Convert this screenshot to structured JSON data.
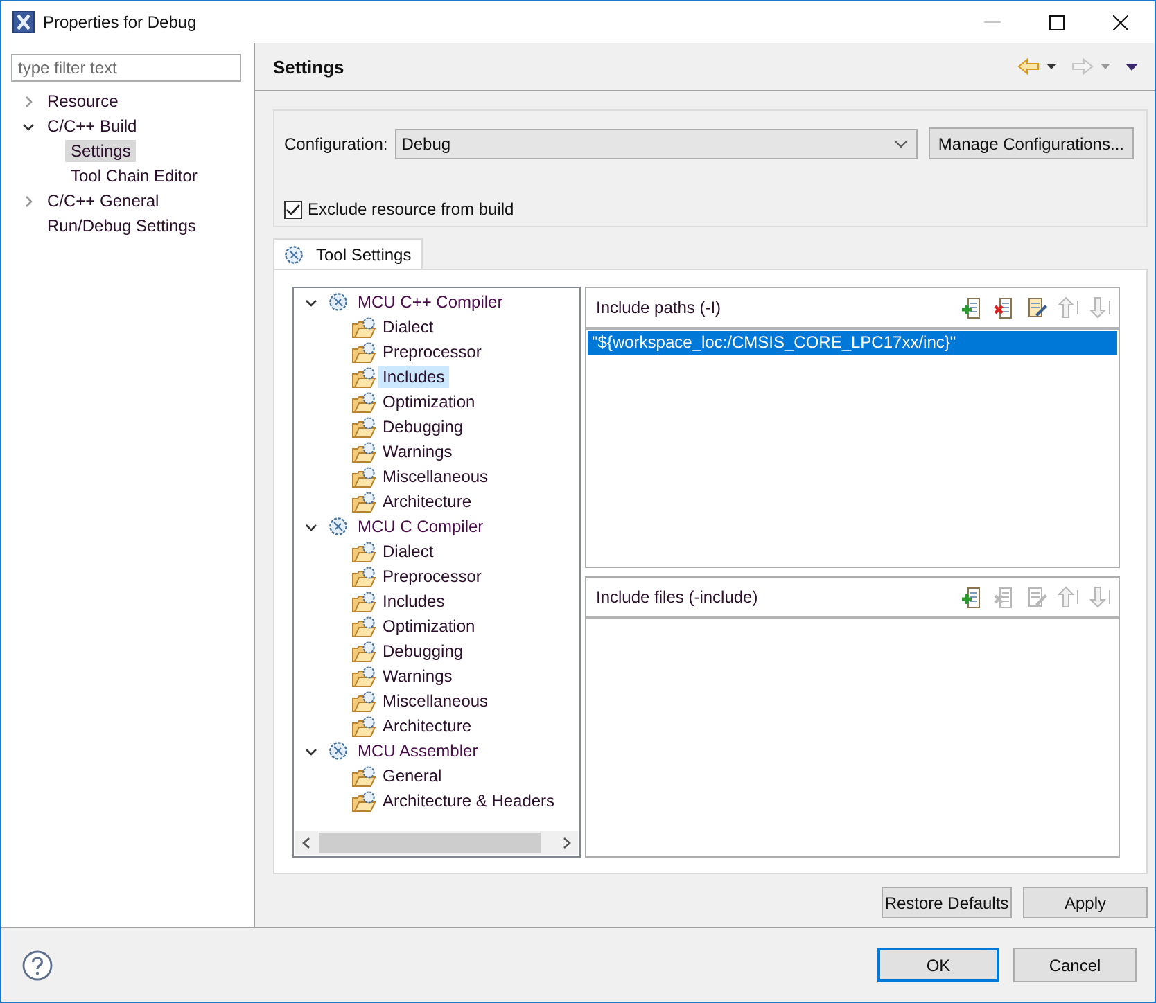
{
  "window": {
    "title": "Properties for Debug"
  },
  "filter": {
    "placeholder": "type filter text"
  },
  "sidebar": {
    "items": [
      {
        "label": "Resource",
        "expanded": false,
        "selected": false
      },
      {
        "label": "C/C++ Build",
        "expanded": true,
        "selected": false,
        "children": [
          {
            "label": "Settings",
            "selected": true
          },
          {
            "label": "Tool Chain Editor",
            "selected": false
          }
        ]
      },
      {
        "label": "C/C++ General",
        "expanded": false,
        "selected": false
      },
      {
        "label": "Run/Debug Settings",
        "selected": false
      }
    ]
  },
  "page": {
    "title": "Settings"
  },
  "configuration": {
    "label": "Configuration:",
    "value": "Debug",
    "manage_button": "Manage Configurations..."
  },
  "exclude": {
    "label": "Exclude resource from build",
    "checked": true
  },
  "tabs": [
    {
      "label": "Tool Settings",
      "selected": true
    }
  ],
  "tool_tree": [
    {
      "label": "MCU C++ Compiler",
      "expanded": true,
      "children": [
        {
          "label": "Dialect",
          "selected": false
        },
        {
          "label": "Preprocessor",
          "selected": false
        },
        {
          "label": "Includes",
          "selected": true
        },
        {
          "label": "Optimization",
          "selected": false
        },
        {
          "label": "Debugging",
          "selected": false
        },
        {
          "label": "Warnings",
          "selected": false
        },
        {
          "label": "Miscellaneous",
          "selected": false
        },
        {
          "label": "Architecture",
          "selected": false
        }
      ]
    },
    {
      "label": "MCU C Compiler",
      "expanded": true,
      "children": [
        {
          "label": "Dialect",
          "selected": false
        },
        {
          "label": "Preprocessor",
          "selected": false
        },
        {
          "label": "Includes",
          "selected": false
        },
        {
          "label": "Optimization",
          "selected": false
        },
        {
          "label": "Debugging",
          "selected": false
        },
        {
          "label": "Warnings",
          "selected": false
        },
        {
          "label": "Miscellaneous",
          "selected": false
        },
        {
          "label": "Architecture",
          "selected": false
        }
      ]
    },
    {
      "label": "MCU Assembler",
      "expanded": true,
      "children": [
        {
          "label": "General",
          "selected": false
        },
        {
          "label": "Architecture & Headers",
          "selected": false
        }
      ]
    }
  ],
  "panels": [
    {
      "title": "Include paths (-I)",
      "tools": [
        {
          "kind": "add",
          "disabled": false
        },
        {
          "kind": "delete",
          "disabled": false
        },
        {
          "kind": "edit",
          "disabled": false
        },
        {
          "kind": "up",
          "disabled": true
        },
        {
          "kind": "down",
          "disabled": true
        }
      ],
      "items": [
        {
          "text": "\"${workspace_loc:/CMSIS_CORE_LPC17xx/inc}\"",
          "selected": true
        }
      ]
    },
    {
      "title": "Include files (-include)",
      "tools": [
        {
          "kind": "add",
          "disabled": false
        },
        {
          "kind": "delete",
          "disabled": true
        },
        {
          "kind": "edit",
          "disabled": true
        },
        {
          "kind": "up",
          "disabled": true
        },
        {
          "kind": "down",
          "disabled": true
        }
      ]
    }
  ],
  "buttons": {
    "restore": "Restore Defaults",
    "apply": "Apply"
  },
  "footer": {
    "ok": "OK",
    "cancel": "Cancel"
  }
}
